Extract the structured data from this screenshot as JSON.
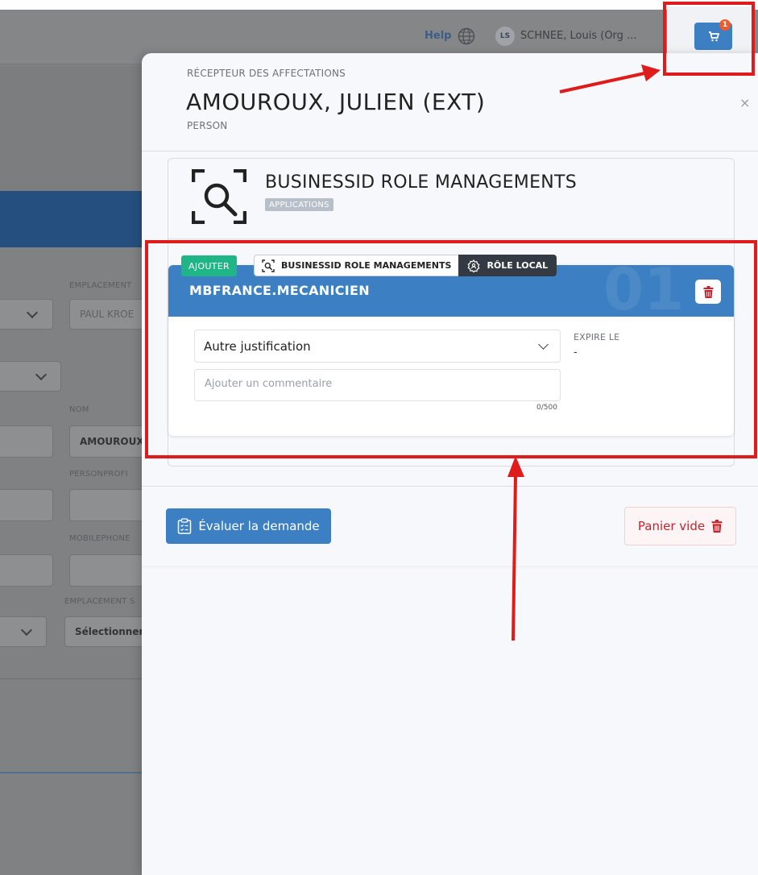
{
  "header": {
    "help": "Help",
    "user_initials": "LS",
    "user_name": "SCHNEE, Louis (Org ...",
    "cart_count": "1"
  },
  "background_form": {
    "labels": {
      "emplacement": "EMPLACEMENT",
      "nom": "NOM",
      "personprofile": "PERSONPROFI",
      "mobilephone": "MOBILEPHONE",
      "emplacement_s": "EMPLACEMENT S"
    },
    "values": {
      "emplacement": "PAUL KROE",
      "nom": "AMOUROUX",
      "emplacement_s": "Sélectionner"
    }
  },
  "drawer": {
    "eyebrow": "RÉCEPTEUR DES AFFECTATIONS",
    "person_name": "AMOUROUX, JULIEN (EXT)",
    "person_type": "PERSON",
    "close": "×",
    "application": {
      "title": "BUSINESSID ROLE MANAGEMENTS",
      "tag": "APPLICATIONS"
    },
    "role": {
      "action_badge": "AJOUTER",
      "crumb_app": "BUSINESSID ROLE MANAGEMENTS",
      "crumb_role": "RÔLE LOCAL",
      "name": "MBFRANCE.MECANICIEN",
      "index": "01",
      "justification": "Autre justification",
      "comment_placeholder": "Ajouter un commentaire",
      "counter": "0/500",
      "expire_label": "EXPIRE LE",
      "expire_value": "-"
    },
    "footer": {
      "evaluate": "Évaluer la demande",
      "empty_cart": "Panier vide"
    }
  },
  "colors": {
    "primary": "#3d7fc3",
    "success": "#1fb586",
    "danger": "#c8232c",
    "annotation": "#e01b1b",
    "dark_chip": "#343a43"
  }
}
